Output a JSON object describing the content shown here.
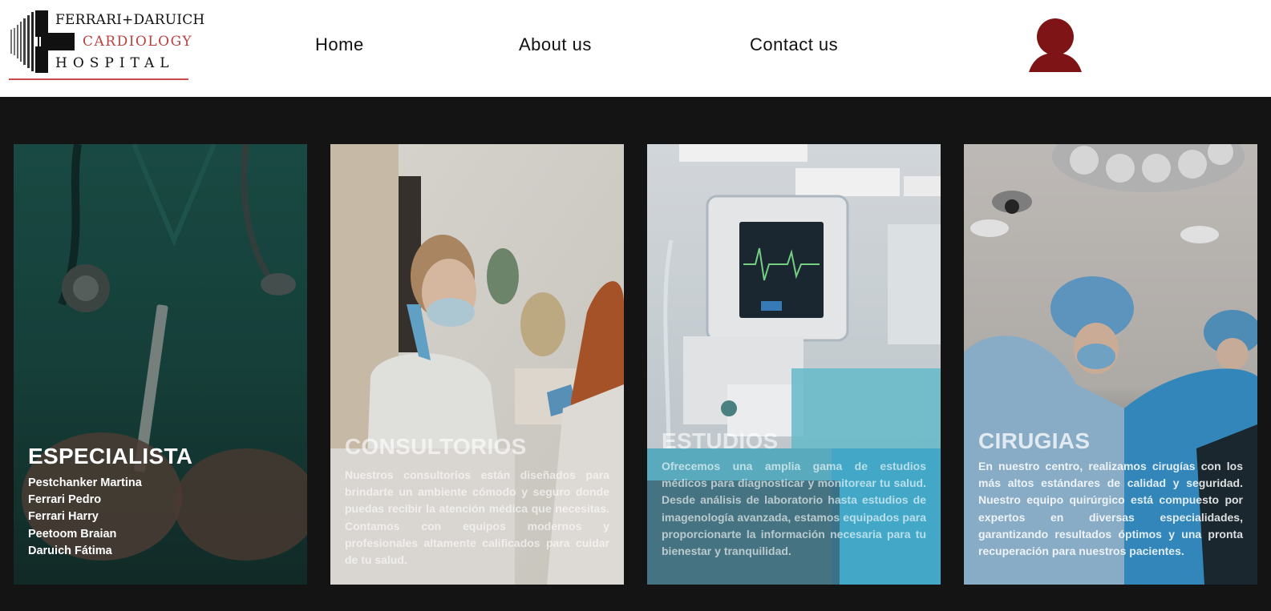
{
  "header": {
    "logo": {
      "line1": "FERRARI+DARUICH",
      "line2": "CARDIOLOGY",
      "line3": "HOSPITAL"
    },
    "nav": {
      "home": "Home",
      "about": "About us",
      "contact": "Contact us"
    },
    "account_icon": "user-silhouette-icon"
  },
  "cards": [
    {
      "title": "ESPECIALISTA",
      "items": [
        "Pestchanker Martina",
        "Ferrari Pedro",
        "Ferrari Harry",
        "Peetoom Braian",
        "Daruich Fátima"
      ]
    },
    {
      "title": "CONSULTORIOS",
      "body": "Nuestros consultorios están diseñados para brindarte un ambiente cómodo y seguro donde puedas recibir la atención médica que necesitas. Contamos con equipos modernos y profesionales altamente calificados para cuidar de tu salud."
    },
    {
      "title": "ESTUDIOS",
      "body": "Ofrecemos una amplia gama de estudios médicos para diagnosticar y monitorear tu salud. Desde análisis de laboratorio hasta estudios de imagenología avanzada, estamos equipados para proporcionarte la información necesaria para tu bienestar y tranquilidad."
    },
    {
      "title": "CIRUGIAS",
      "body": "En nuestro centro, realizamos cirugías con los más altos estándares de calidad y seguridad. Nuestro equipo quirúrgico está compuesto por expertos en diversas especialidades, garantizando resultados óptimos y una pronta recuperación para nuestros pacientes."
    }
  ],
  "colors": {
    "header_bg": "#ffffff",
    "page_bg": "#141414",
    "brand_red": "#7f1416",
    "logo_accent": "#b84040"
  }
}
